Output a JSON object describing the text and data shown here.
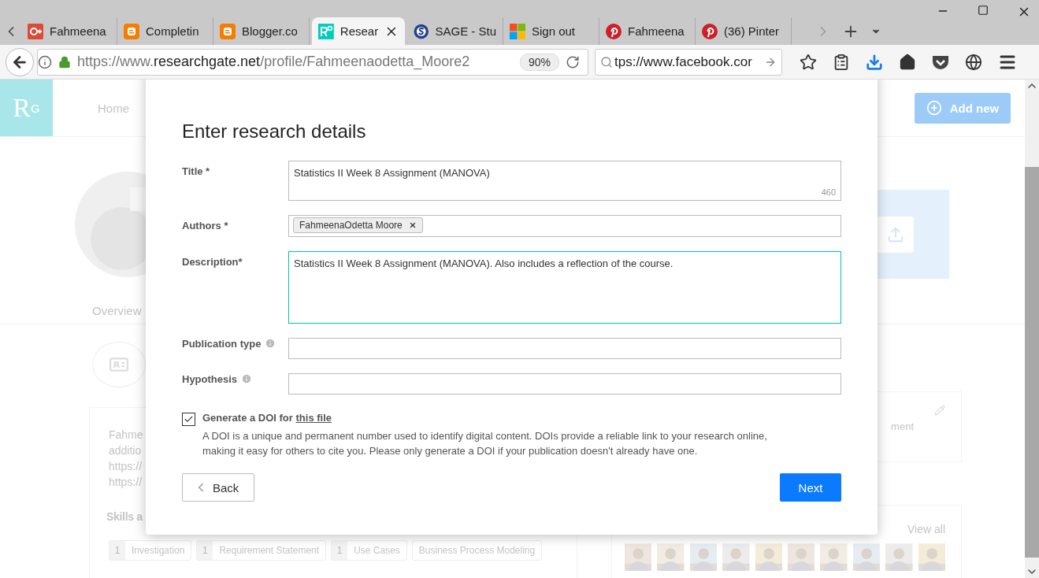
{
  "browser": {
    "tabs": [
      {
        "label": "Fahmeena",
        "kind": "gplus",
        "selected": false
      },
      {
        "label": "Completin",
        "kind": "blogger",
        "selected": false
      },
      {
        "label": "Blogger.co",
        "kind": "blogger",
        "selected": false
      },
      {
        "label": "Resear",
        "kind": "rg",
        "selected": true
      },
      {
        "label": "SAGE - Stu",
        "kind": "sage",
        "selected": false
      },
      {
        "label": "Sign out",
        "kind": "windows",
        "selected": false
      },
      {
        "label": "Fahmeena",
        "kind": "pinterest",
        "selected": false
      },
      {
        "label": "(36) Pinter",
        "kind": "pinterest",
        "selected": false
      }
    ],
    "url": {
      "scheme": "https://www.",
      "domain": "researchgate.net",
      "path": "/profile/Fahmeenaodetta_Moore2"
    },
    "zoom": "90%",
    "search_value": "tps://www.facebook.cor"
  },
  "page": {
    "logo": {
      "letter": "R",
      "raised": "G"
    },
    "nav_home": "Home",
    "add_new": "Add new",
    "overview_tab": "Overview",
    "about_lines": [
      "Fahme",
      "additio",
      "https://",
      "https://"
    ],
    "skills_heading": "Skills a",
    "skills": [
      {
        "count": "1",
        "label": "Investigation"
      },
      {
        "count": "1",
        "label": "Requirement Statement"
      },
      {
        "count": "1",
        "label": "Use Cases"
      },
      {
        "label": "Business Process Modeling"
      }
    ],
    "side_fragment": "ment",
    "view_all": "View all"
  },
  "dialog": {
    "title": "Enter research details",
    "fields": [
      {
        "kind": "counted",
        "label": "Title *",
        "value": "Statistics II Week 8 Assignment (MANOVA)",
        "counter": "460",
        "focused": false
      },
      {
        "kind": "tags",
        "label": "Authors *",
        "tags": [
          "FahmeenaOdetta Moore"
        ],
        "focused": false
      },
      {
        "kind": "multiline",
        "label": "Description*",
        "value": "Statistics II Week 8 Assignment (MANOVA). Also includes a reflection of the course.",
        "focused": true
      },
      {
        "kind": "single",
        "label": "Publication type",
        "focused": false,
        "info": true
      },
      {
        "kind": "single",
        "label": "Hypothesis",
        "focused": false,
        "info": true
      }
    ],
    "doi": {
      "checked": true,
      "label": "Generate a DOI for",
      "link": "this file",
      "note": "A DOI is a unique and permanent number used to identify digital content. DOIs provide a reliable link to your research online, making it easy for others to cite you. Please only generate a DOI if your publication doesn't already have one."
    },
    "back": "Back",
    "next": "Next"
  }
}
